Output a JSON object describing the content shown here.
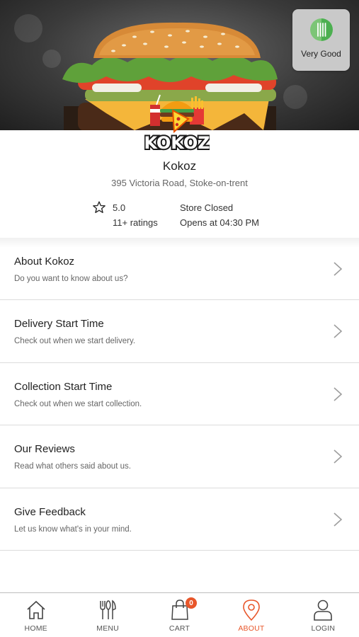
{
  "hygiene": {
    "label": "Very Good"
  },
  "logo": {
    "text": "KOKOZ"
  },
  "store": {
    "name": "Kokoz",
    "address": "395 Victoria Road, Stoke-on-trent",
    "rating": "5.0",
    "ratings_count": "11+ ratings",
    "status": "Store Closed",
    "opens_at": "Opens at 04:30 PM"
  },
  "menu": {
    "items": [
      {
        "title": "About Kokoz",
        "subtitle": "Do you want to know about us?"
      },
      {
        "title": "Delivery Start Time",
        "subtitle": "Check out when we start delivery."
      },
      {
        "title": "Collection Start Time",
        "subtitle": "Check out when we start collection."
      },
      {
        "title": "Our Reviews",
        "subtitle": "Read what others said about us."
      },
      {
        "title": "Give Feedback",
        "subtitle": "Let us know what's in your mind."
      }
    ]
  },
  "nav": {
    "home": "HOME",
    "menu": "MENU",
    "cart": "CART",
    "cart_count": "0",
    "about": "ABOUT",
    "login": "LOGIN",
    "active": "about"
  },
  "colors": {
    "accent": "#e8562a",
    "hygiene_green": "#4caf50"
  },
  "icons": [
    "star-icon",
    "chevron-right-icon",
    "home-icon",
    "cutlery-icon",
    "shopping-bag-icon",
    "location-pin-icon",
    "user-icon",
    "hygiene-rating-icon"
  ]
}
